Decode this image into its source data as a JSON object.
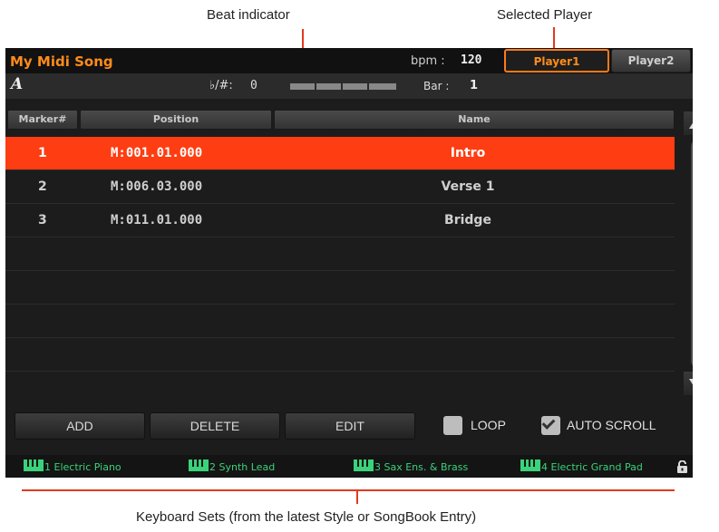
{
  "annotations": {
    "beat_indicator": "Beat indicator",
    "selected_player": "Selected Player",
    "keyboard_sets": "Keyboard Sets (from the latest Style or SongBook Entry)"
  },
  "header": {
    "song_title": "My Midi Song",
    "bpm_label": "bpm :",
    "bpm_value": "120",
    "players": [
      "Player1",
      "Player2"
    ],
    "selected_player": "Player1"
  },
  "info": {
    "chord": "A",
    "transpose_label": "♭/#:",
    "transpose_value": "0",
    "bar_label": "Bar :",
    "bar_value": "1"
  },
  "table": {
    "columns": [
      "Marker#",
      "Position",
      "Name"
    ],
    "rows": [
      {
        "num": "1",
        "position": "M:001.01.000",
        "name": "Intro",
        "selected": true
      },
      {
        "num": "2",
        "position": "M:006.03.000",
        "name": "Verse 1",
        "selected": false
      },
      {
        "num": "3",
        "position": "M:011.01.000",
        "name": "Bridge",
        "selected": false
      },
      {
        "num": "",
        "position": "",
        "name": "",
        "selected": false
      },
      {
        "num": "",
        "position": "",
        "name": "",
        "selected": false
      },
      {
        "num": "",
        "position": "",
        "name": "",
        "selected": false
      },
      {
        "num": "",
        "position": "",
        "name": "",
        "selected": false
      },
      {
        "num": "",
        "position": "",
        "name": "",
        "selected": false
      }
    ]
  },
  "buttons": {
    "add": "ADD",
    "delete": "DELETE",
    "edit": "EDIT",
    "loop_label": "LOOP",
    "loop_checked": false,
    "autoscroll_label": "AUTO SCROLL",
    "autoscroll_checked": true
  },
  "keyboard_sets": [
    {
      "num": "1",
      "name": "Electric Piano"
    },
    {
      "num": "2",
      "name": "Synth Lead"
    },
    {
      "num": "3",
      "name": "Sax Ens. & Brass"
    },
    {
      "num": "4",
      "name": "Electric Grand Pad"
    }
  ],
  "colors": {
    "accent_orange": "#ff8c1a",
    "selected_row": "#ff3d12",
    "keyboard_set_green": "#3ad27a",
    "callout_red": "#e03a1e"
  }
}
